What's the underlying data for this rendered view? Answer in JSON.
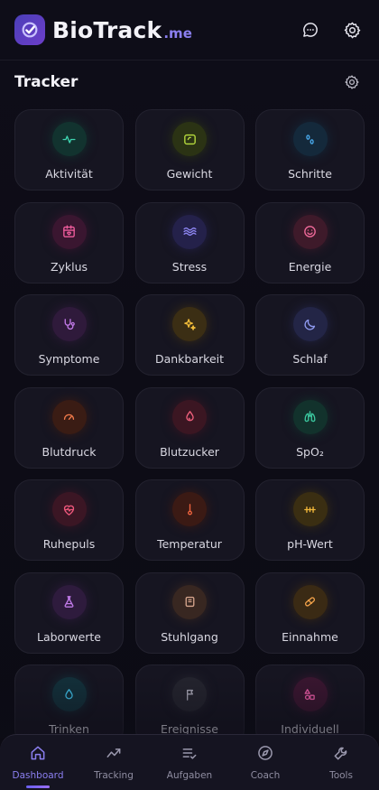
{
  "header": {
    "brand_main": "BioTrack",
    "brand_suffix": ".me"
  },
  "section": {
    "title": "Tracker"
  },
  "trackers": [
    {
      "label": "Aktivität",
      "icon": "activity-icon",
      "bg": "#12332f",
      "fg": "#3fd4b0"
    },
    {
      "label": "Gewicht",
      "icon": "scale-icon",
      "bg": "#2b3314",
      "fg": "#b9dd3e"
    },
    {
      "label": "Schritte",
      "icon": "footprints-icon",
      "bg": "#14293b",
      "fg": "#48a8ea"
    },
    {
      "label": "Zyklus",
      "icon": "calendar-heart-icon",
      "bg": "#3a1630",
      "fg": "#ee5c9c"
    },
    {
      "label": "Stress",
      "icon": "waves-icon",
      "bg": "#24214a",
      "fg": "#8e86f2"
    },
    {
      "label": "Energie",
      "icon": "smile-icon",
      "bg": "#3e1a2a",
      "fg": "#f06a9a"
    },
    {
      "label": "Symptome",
      "icon": "stethoscope-icon",
      "bg": "#2f1a3b",
      "fg": "#c27ae8"
    },
    {
      "label": "Dankbarkeit",
      "icon": "sparkles-icon",
      "bg": "#3b2e14",
      "fg": "#f2bd3a"
    },
    {
      "label": "Schlaf",
      "icon": "moon-icon",
      "bg": "#232546",
      "fg": "#8f9af0"
    },
    {
      "label": "Blutdruck",
      "icon": "gauge-icon",
      "bg": "#3a1c14",
      "fg": "#f07a4a"
    },
    {
      "label": "Blutzucker",
      "icon": "droplet-icon",
      "bg": "#3b1622",
      "fg": "#f0607c"
    },
    {
      "label": "SpO₂",
      "icon": "lungs-icon",
      "bg": "#12322c",
      "fg": "#3cc9a0"
    },
    {
      "label": "Ruhepuls",
      "icon": "heart-pulse-icon",
      "bg": "#3b1624",
      "fg": "#f0587c"
    },
    {
      "label": "Temperatur",
      "icon": "thermometer-icon",
      "bg": "#3b1a14",
      "fg": "#f0643e"
    },
    {
      "label": "pH-Wert",
      "icon": "ph-scale-icon",
      "bg": "#3a2e12",
      "fg": "#f2b83a"
    },
    {
      "label": "Laborwerte",
      "icon": "flask-icon",
      "bg": "#2e1b3d",
      "fg": "#c07ae8"
    },
    {
      "label": "Stuhlgang",
      "icon": "toilet-paper-icon",
      "bg": "#382721",
      "fg": "#d4a48c"
    },
    {
      "label": "Einnahme",
      "icon": "pill-icon",
      "bg": "#3a2a14",
      "fg": "#f2a24a"
    },
    {
      "label": "Trinken",
      "icon": "water-drop-icon",
      "bg": "#13303a",
      "fg": "#3fc0e8"
    },
    {
      "label": "Ereignisse",
      "icon": "flag-icon",
      "bg": "#24242e",
      "fg": "#a9a8b6"
    },
    {
      "label": "Individuell",
      "icon": "shapes-icon",
      "bg": "#3a1630",
      "fg": "#ee5ca8"
    }
  ],
  "nav": [
    {
      "label": "Dashboard",
      "icon": "home-icon"
    },
    {
      "label": "Tracking",
      "icon": "trend-icon"
    },
    {
      "label": "Aufgaben",
      "icon": "tasks-icon"
    },
    {
      "label": "Coach",
      "icon": "compass-icon"
    },
    {
      "label": "Tools",
      "icon": "wrench-icon"
    }
  ],
  "colors": {
    "accent": "#8b7ff0",
    "background": "#0d0c16",
    "tile": "#161521"
  }
}
